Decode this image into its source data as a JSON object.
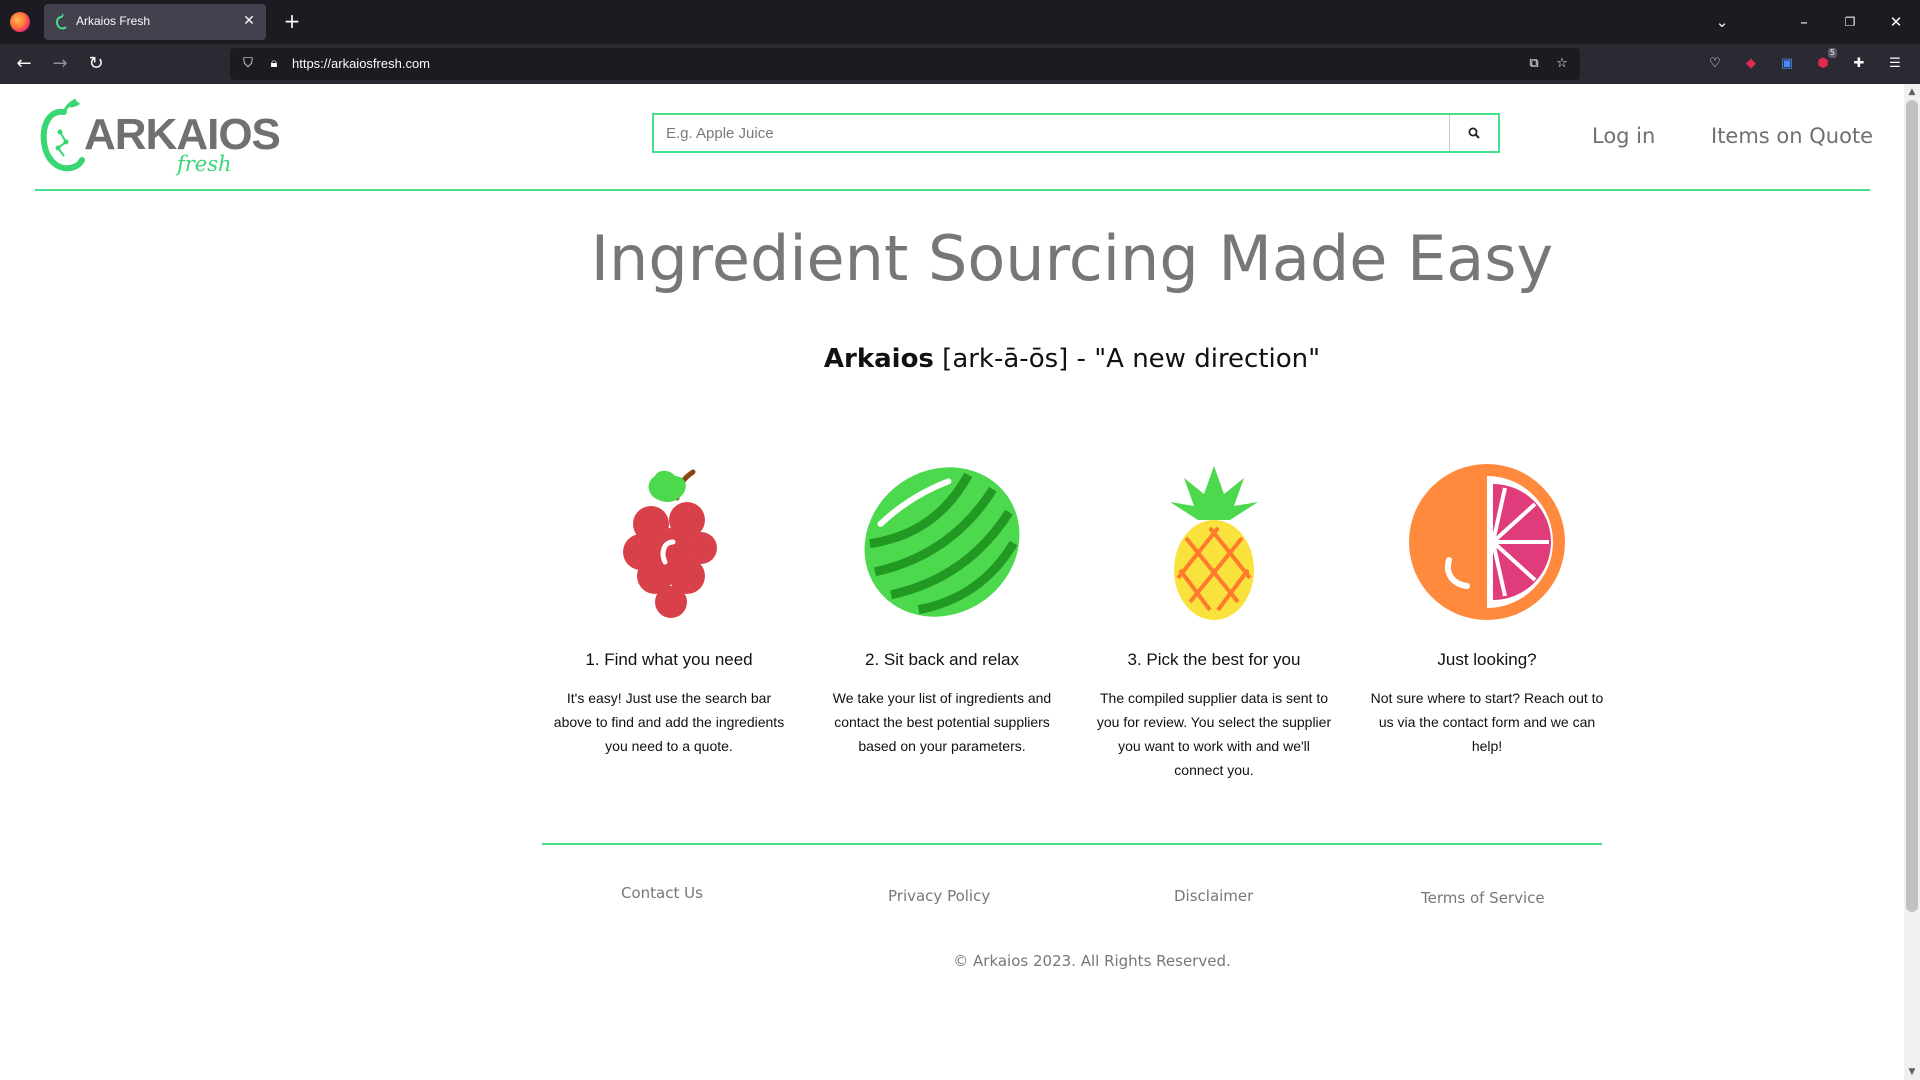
{
  "browser": {
    "tab_title": "Arkaios Fresh",
    "url": "https://arkaiosfresh.com",
    "extension_badge": "5"
  },
  "header": {
    "logo_word": "ARKAIOS",
    "logo_fresh": "fresh",
    "search_placeholder": "E.g. Apple Juice",
    "login_label": "Log in",
    "quote_label": "Items on Quote"
  },
  "hero": {
    "title": "Ingredient Sourcing Made Easy",
    "brand": "Arkaios",
    "pronunciation": " [ark-ā-ōs] - \"A new direction\""
  },
  "steps": [
    {
      "icon": "grapes-icon",
      "title": "1. Find what you need",
      "text": "It's easy! Just use the search bar above to find and add the ingredients you need to a quote."
    },
    {
      "icon": "watermelon-icon",
      "title": "2. Sit back and relax",
      "text": "We take your list of ingredients and contact the best potential suppliers based on your parameters."
    },
    {
      "icon": "pineapple-icon",
      "title": "3. Pick the best for you",
      "text": "The compiled supplier data is sent to you for review. You select the supplier you want to work with and we'll connect you."
    },
    {
      "icon": "orange-slice-icon",
      "title": "Just looking?",
      "text": "Not sure where to start? Reach out to us via the contact form and we can help!"
    }
  ],
  "footer": {
    "contact": "Contact Us",
    "privacy": "Privacy Policy",
    "disclaimer": "Disclaimer",
    "terms": "Terms of Service",
    "copyright": "© Arkaios 2023. All Rights Reserved."
  },
  "colors": {
    "accent_green": "#46e08a",
    "muted_text": "#777777",
    "browser_dark": "#1c1b22"
  }
}
